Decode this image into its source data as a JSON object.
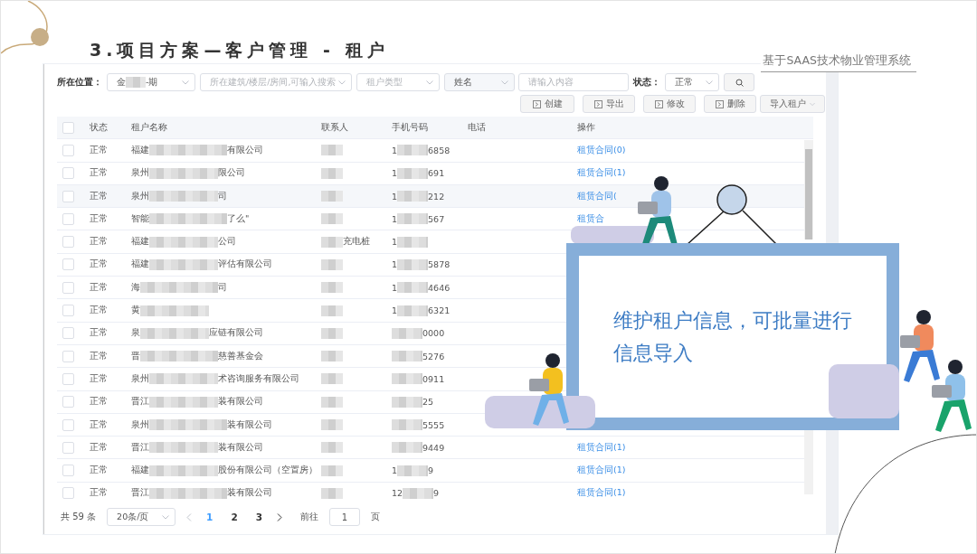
{
  "slide": {
    "title": "3.项目方案—客户管理 - 租户",
    "subtitle": "基于SAAS技术物业管理系统"
  },
  "filters": {
    "location_label": "所在位置：",
    "location_start": "金",
    "location_end": "-期",
    "building_placeholder": "所在建筑/楼层/房间,可输入搜索",
    "type_placeholder": "租户类型",
    "field_select": "姓名",
    "search_placeholder": "请输入内容",
    "status_label": "状态：",
    "status_value": "正常"
  },
  "toolbar": [
    {
      "label": "创建",
      "kind": "icon"
    },
    {
      "label": "导出",
      "kind": "icon"
    },
    {
      "label": "修改",
      "kind": "icon"
    },
    {
      "label": "删除",
      "kind": "icon"
    },
    {
      "label": "导入租户",
      "kind": "dropdown"
    }
  ],
  "table": {
    "header_checked": false,
    "columns": [
      "状态",
      "租户名称",
      "联系人",
      "手机号码",
      "电话",
      "操作"
    ],
    "rows": [
      {
        "checked": false,
        "status": "正常",
        "name_start": "福建",
        "name_end": "有限公司",
        "phone_start": "1",
        "phone_end": "6858",
        "contract": "租赁合同(0)"
      },
      {
        "checked": false,
        "status": "正常",
        "name_start": "泉州",
        "name_end": "限公司",
        "phone_start": "1",
        "phone_end": "691",
        "contract": "租赁合同(1)"
      },
      {
        "checked": false,
        "status": "正常",
        "name_start": "泉州",
        "name_end": "司",
        "phone_start": "1",
        "phone_end": "212",
        "contract": "租赁合同("
      },
      {
        "checked": false,
        "status": "正常",
        "name_start": "智能",
        "name_end": "了么\"",
        "phone_start": "1",
        "phone_end": "567",
        "contract": "租赁合"
      },
      {
        "checked": false,
        "status": "正常",
        "name_start": "福建",
        "name_end": "公司",
        "contact_end": "充电桩",
        "phone_start": "1"
      },
      {
        "checked": false,
        "status": "正常",
        "name_start": "福建",
        "name_end": "评估有限公司",
        "phone_start": "1",
        "phone_end": "5878"
      },
      {
        "checked": false,
        "status": "正常",
        "name_start": "海",
        "name_end": "司",
        "phone_start": "1",
        "phone_end": "4646"
      },
      {
        "checked": false,
        "status": "正常",
        "name_start": "黄",
        "phone_start": "1",
        "phone_end": "6321"
      },
      {
        "checked": false,
        "status": "正常",
        "name_start": "泉",
        "name_end": "应链有限公司",
        "phone_end": "0000"
      },
      {
        "checked": false,
        "status": "正常",
        "name_start": "晋",
        "name_end": "慈善基金会",
        "phone_end": "5276"
      },
      {
        "checked": false,
        "status": "正常",
        "name_start": "泉州",
        "name_end": "术咨询服务有限公司",
        "phone_end": "0911"
      },
      {
        "checked": false,
        "status": "正常",
        "name_start": "晋江",
        "name_end": "装有限公司",
        "phone_end": "25"
      },
      {
        "checked": false,
        "status": "正常",
        "name_start": "泉州",
        "name_end": "装有限公司",
        "phone_end": "5555"
      },
      {
        "checked": false,
        "status": "正常",
        "name_start": "晋江",
        "name_end": "装有限公司",
        "phone_end": "9449",
        "contract": "租赁合同(1)"
      },
      {
        "checked": false,
        "status": "正常",
        "name_start": "福建",
        "name_end": "股份有限公司（空置房）",
        "phone_start": "1",
        "phone_end": "9",
        "contract": "租赁合同(1)"
      },
      {
        "checked": false,
        "status": "正常",
        "name_start": "晋江",
        "name_end": "装有限公司",
        "phone_start": "12",
        "phone_end": "9",
        "contract": "租赁合同(1)"
      }
    ]
  },
  "pagination": {
    "total": "共 59 条",
    "page_size": "20条/页",
    "pages": [
      {
        "label": "1",
        "selected": true
      },
      {
        "label": "2",
        "selected": false
      },
      {
        "label": "3",
        "selected": false
      }
    ],
    "goto_label": "前往",
    "goto_value": "1",
    "goto_suffix": "页"
  },
  "callout": {
    "text": "维护租户信息，可批量进行信息导入"
  }
}
